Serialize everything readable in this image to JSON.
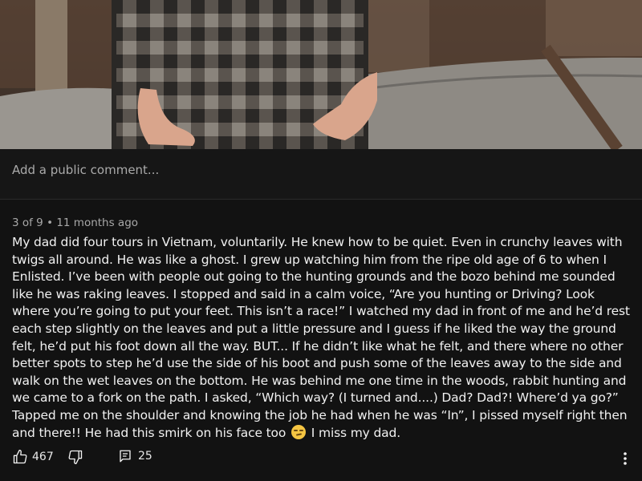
{
  "video": {
    "description_icon": "video-frame"
  },
  "comment_box": {
    "placeholder": "Add a public comment..."
  },
  "comment": {
    "meta": "3 of 9 • 11 months ago",
    "text_before_emoji": "My dad did four tours in Vietnam, voluntarily. He knew how to be quiet. Even in crunchy leaves with twigs all around. He was like a ghost. I grew up watching him from the ripe old age of 6 to when I Enlisted. I’ve been with people out going to the hunting grounds and the bozo behind me sounded like he was raking leaves. I stopped and said in a calm voice, “Are you hunting or Driving? Look where you’re going to put your feet. This isn’t a race!” I watched my dad in front of me and he’d rest each step slightly on the leaves and put a little pressure and I guess if he liked the way the ground felt, he’d put his foot down all the way. BUT... If he didn’t like what he felt, and there where no other better spots to step he’d use the side of his boot and push some of the leaves away to the side and walk on the wet leaves on the bottom. He was behind me one time in the woods, rabbit hunting and we came to a fork on the path. I asked, “Which way? (I turned and....) Dad? Dad?! Where’d ya go?” Tapped me on the shoulder and knowing the job he had when he was “In”, I pissed myself right then and there!! He had this smirk on his face too",
    "text_after_emoji": "I miss my dad.",
    "emoji": "smirking-face"
  },
  "actions": {
    "likes": "467",
    "replies": "25"
  }
}
